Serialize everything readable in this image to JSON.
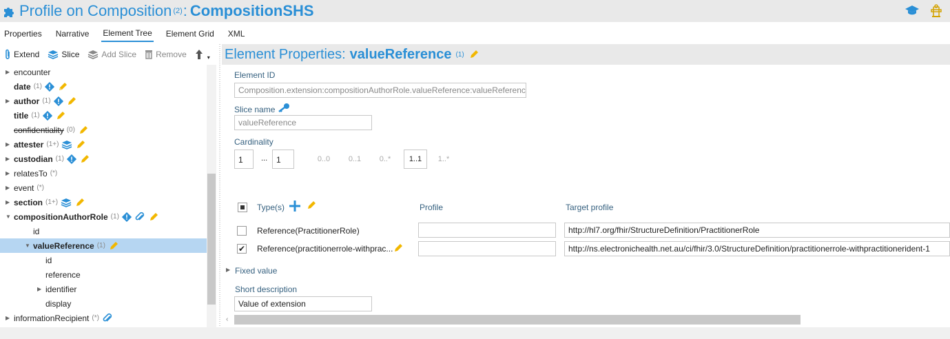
{
  "title": {
    "prefix": "Profile on Composition",
    "sup": "(2)",
    "colon": ":",
    "name": "CompositionSHS"
  },
  "tabs": [
    "Properties",
    "Narrative",
    "Element Tree",
    "Element Grid",
    "XML"
  ],
  "toolbar": {
    "extend": "Extend",
    "slice": "Slice",
    "add_slice": "Add Slice",
    "remove": "Remove"
  },
  "tree": [
    {
      "label": "encounter",
      "card": "",
      "bold": false
    },
    {
      "label": "date",
      "card": "(1)",
      "bold": true
    },
    {
      "label": "author",
      "card": "(1)",
      "bold": true
    },
    {
      "label": "title",
      "card": "(1)",
      "bold": true
    },
    {
      "label": "confidentiality",
      "card": "(0)",
      "bold": false
    },
    {
      "label": "attester",
      "card": "(1+)",
      "bold": true
    },
    {
      "label": "custodian",
      "card": "(1)",
      "bold": true
    },
    {
      "label": "relatesTo",
      "card": "(*)",
      "bold": false
    },
    {
      "label": "event",
      "card": "(*)",
      "bold": false
    },
    {
      "label": "section",
      "card": "(1+)",
      "bold": true
    },
    {
      "label": "compositionAuthorRole",
      "card": "(1)",
      "bold": true
    },
    {
      "label": "id",
      "card": "",
      "bold": false
    },
    {
      "label": "valueReference",
      "card": "(1)",
      "bold": true
    },
    {
      "label": "id",
      "card": "",
      "bold": false
    },
    {
      "label": "reference",
      "card": "",
      "bold": false
    },
    {
      "label": "identifier",
      "card": "",
      "bold": false
    },
    {
      "label": "display",
      "card": "",
      "bold": false
    },
    {
      "label": "informationRecipient",
      "card": "(*)",
      "bold": false
    }
  ],
  "element": {
    "header": "Element Properties:",
    "name": "valueReference",
    "card": "(1)",
    "id_label": "Element ID",
    "id_value": "Composition.extension:compositionAuthorRole.valueReference:valueReference",
    "slice_label": "Slice name",
    "slice_value": "valueReference",
    "cardinality_label": "Cardinality",
    "min": "1",
    "dots": "...",
    "max": "1",
    "presets": [
      "0..0",
      "0..1",
      "0..*",
      "1..1",
      "1..*"
    ],
    "types_label": "Type(s)",
    "profile_label": "Profile",
    "target_label": "Target profile",
    "types": [
      {
        "name": "Reference(PractitionerRole)",
        "profile": "",
        "target": "http://hl7.org/fhir/StructureDefinition/PractitionerRole",
        "checked": false
      },
      {
        "name": "Reference(practitionerrole-withprac...",
        "profile": "",
        "target": "http://ns.electronichealth.net.au/ci/fhir/3.0/StructureDefinition/practitionerrole-withpractitionerident-1",
        "checked": true
      }
    ],
    "fixed_label": "Fixed value",
    "short_label": "Short description",
    "short_value": "Value of extension"
  }
}
